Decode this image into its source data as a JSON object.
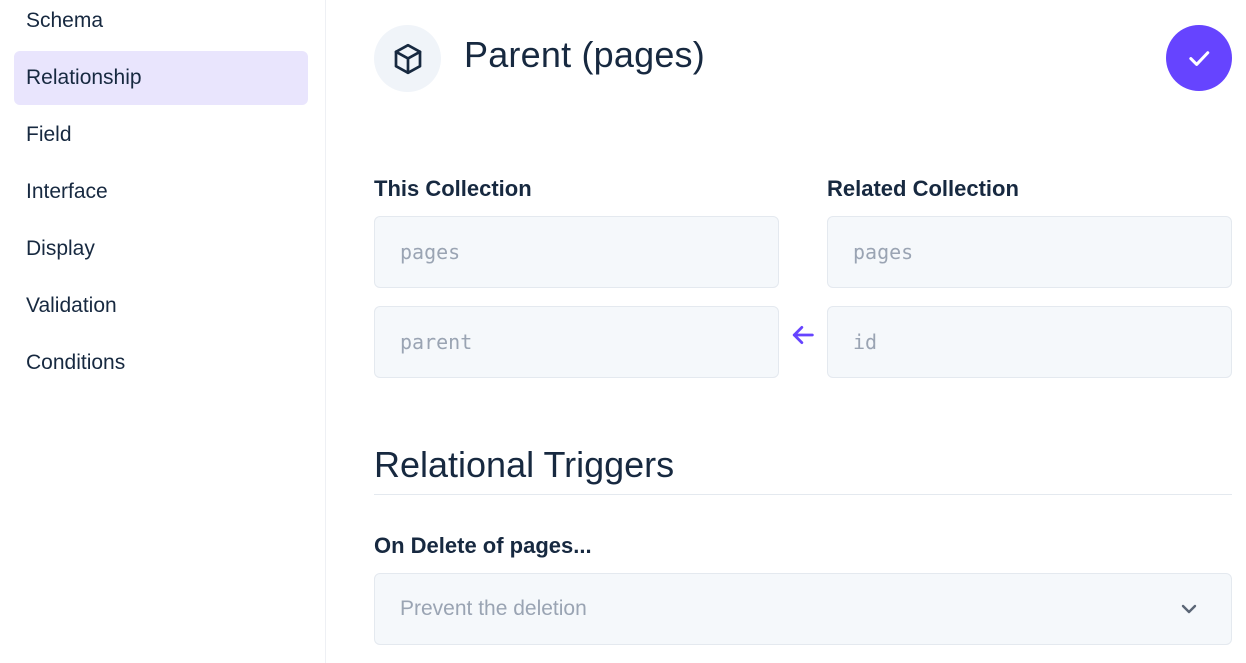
{
  "sidebar": {
    "items": [
      {
        "label": "Schema"
      },
      {
        "label": "Relationship",
        "active": true
      },
      {
        "label": "Field"
      },
      {
        "label": "Interface"
      },
      {
        "label": "Display"
      },
      {
        "label": "Validation"
      },
      {
        "label": "Conditions"
      }
    ]
  },
  "header": {
    "icon": "box-icon",
    "title": "Parent (pages)",
    "confirm_icon": "check-icon"
  },
  "relationship": {
    "this_collection_label": "This Collection",
    "related_collection_label": "Related Collection",
    "this_collection_value": "pages",
    "this_field_value": "parent",
    "related_collection_value": "pages",
    "related_field_value": "id",
    "arrow_icon": "arrow-left-icon"
  },
  "triggers": {
    "title": "Relational Triggers",
    "on_delete_label": "On Delete of pages...",
    "on_delete_value": "Prevent the deletion",
    "dropdown_icon": "chevron-down-icon"
  },
  "colors": {
    "accent": "#6644ff",
    "active_nav": "#e9e5fd",
    "text": "#172940",
    "muted": "#9aa4b3",
    "field_bg": "#f5f8fb"
  }
}
